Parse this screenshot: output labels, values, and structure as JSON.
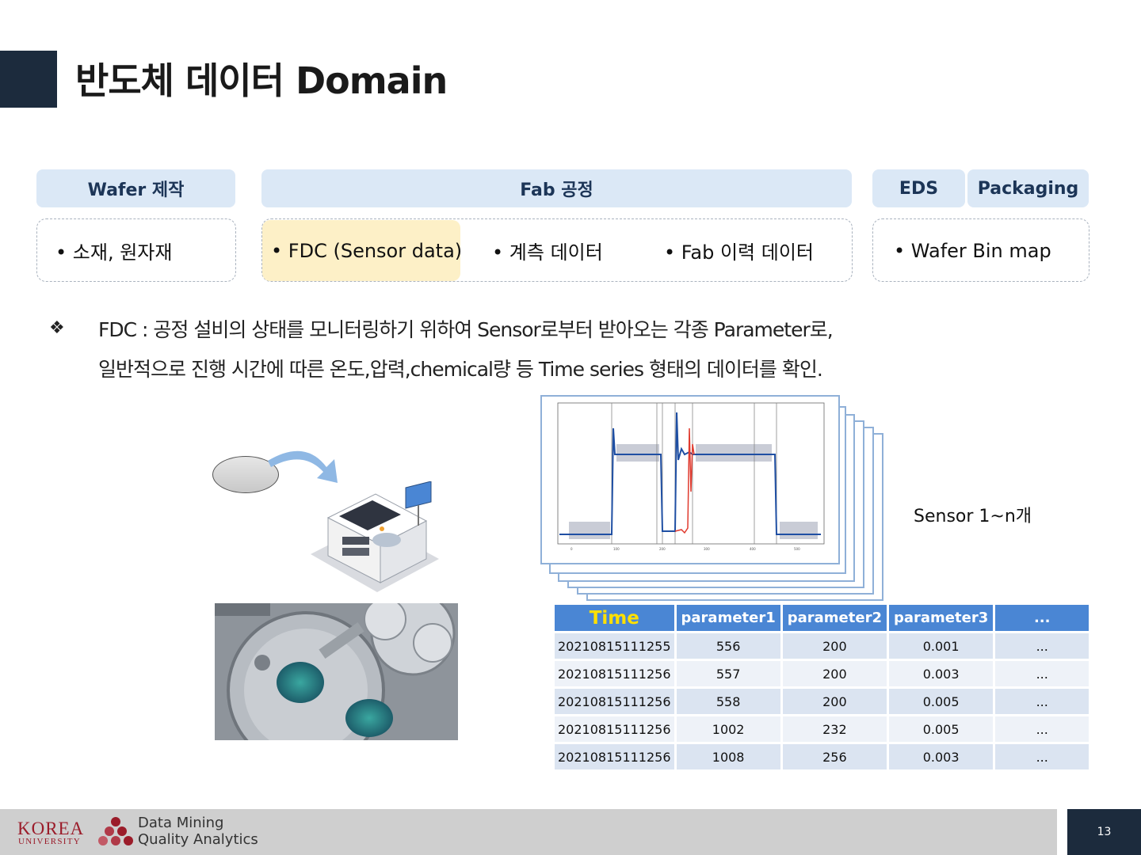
{
  "title": "반도체 데이터 Domain",
  "stages": [
    {
      "header": "Wafer 제작",
      "items": [
        "소재, 원자재"
      ]
    },
    {
      "header": "Fab 공정",
      "items": [
        "FDC (Sensor data)",
        "계측 데이터",
        "Fab 이력 데이터"
      ]
    },
    {
      "header": "EDS",
      "items": [
        "Wafer Bin map"
      ]
    },
    {
      "header": "Packaging",
      "items": []
    }
  ],
  "description": {
    "marker": "❖",
    "line1": "FDC :  공정 설비의 상태를 모니터링하기 위하여 Sensor로부터 받아오는 각종 Parameter로,",
    "line2": "일반적으로 진행 시간에 따른 온도,압력,chemical량 등 Time series 형태의 데이터를 확인."
  },
  "sensor_label": "Sensor 1~n개",
  "table": {
    "headers": [
      "Time",
      "parameter1",
      "parameter2",
      "parameter3",
      "..."
    ],
    "rows": [
      [
        "20210815111255",
        "556",
        "200",
        "0.001",
        "..."
      ],
      [
        "20210815111256",
        "557",
        "200",
        "0.003",
        "..."
      ],
      [
        "20210815111256",
        "558",
        "200",
        "0.005",
        "..."
      ],
      [
        "20210815111256",
        "1002",
        "232",
        "0.005",
        "..."
      ],
      [
        "20210815111256",
        "1008",
        "256",
        "0.003",
        "..."
      ]
    ]
  },
  "footer": {
    "university": "KOREA",
    "university_sub": "UNIVERSITY",
    "lab_line1": "Data Mining",
    "lab_line2": "Quality Analytics",
    "page_number": "13"
  },
  "colors": {
    "title_accent": "#1c2b3d",
    "stage_header_bg": "#dbe8f6",
    "highlight": "#fdf0c7",
    "table_header": "#4a86d4",
    "time_header_text": "#ffe000",
    "series_blue": "#1f4fa3",
    "series_red": "#e03a2e"
  }
}
